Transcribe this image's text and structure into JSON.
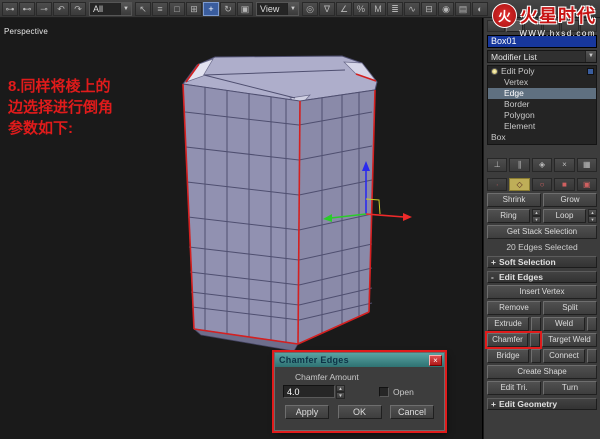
{
  "ui": {
    "dropdown_arrow": "▼",
    "spinner_up": "▲",
    "spinner_down": "▼",
    "close_glyph": "×"
  },
  "colors": {
    "highlight_red": "#e01b1b",
    "selected_edge": "#d42020",
    "dialog_title_teal": "#3f8f8f",
    "object_name_blue": "#17379d",
    "face_lavender": "#9191b1"
  },
  "toolbar": {
    "selection_filter": "All",
    "ref_coord": "View",
    "icons": [
      {
        "name": "select-and-link",
        "glyph": "⊶"
      },
      {
        "name": "unlink-selection",
        "glyph": "⊷"
      },
      {
        "name": "bind-to-space-warp",
        "glyph": "⊸"
      },
      {
        "name": "undo",
        "glyph": "↶"
      },
      {
        "name": "redo",
        "glyph": "↷"
      },
      {
        "name": "select-object",
        "glyph": "↖"
      },
      {
        "name": "select-by-name",
        "glyph": "≡"
      },
      {
        "name": "rectangular-selection",
        "glyph": "□"
      },
      {
        "name": "window-crossing",
        "glyph": "⊞"
      },
      {
        "name": "select-and-move",
        "glyph": "+"
      },
      {
        "name": "select-and-rotate",
        "glyph": "↻"
      },
      {
        "name": "select-and-scale",
        "glyph": "▣"
      },
      {
        "name": "use-pivot-center",
        "glyph": "◎"
      },
      {
        "name": "snap-toggle",
        "glyph": "∇"
      },
      {
        "name": "angle-snap",
        "glyph": "∠"
      },
      {
        "name": "percent-snap",
        "glyph": "%"
      },
      {
        "name": "mirror",
        "glyph": "M"
      },
      {
        "name": "align",
        "glyph": "≣"
      },
      {
        "name": "curve-editor",
        "glyph": "∿"
      },
      {
        "name": "schematic-view",
        "glyph": "⊟"
      },
      {
        "name": "material-editor",
        "glyph": "◉"
      },
      {
        "name": "render-setup",
        "glyph": "▤"
      },
      {
        "name": "quick-render",
        "glyph": "◐"
      }
    ]
  },
  "viewport": {
    "label": "Perspective",
    "annotation_lines": [
      "8.同样将棱上的",
      "边选择进行倒角",
      "参数如下:"
    ]
  },
  "dialog": {
    "title": "Chamfer Edges",
    "amount_label": "Chamfer Amount",
    "amount_value": "4.0",
    "open_label": "Open",
    "buttons": {
      "apply": "Apply",
      "ok": "OK",
      "cancel": "Cancel"
    }
  },
  "panel": {
    "object_name": "Box01",
    "modifier_list_label": "Modifier List",
    "stack_items": [
      {
        "label": "Edit Poly"
      },
      {
        "label": "Vertex"
      },
      {
        "label": "Edge"
      },
      {
        "label": "Border"
      },
      {
        "label": "Polygon"
      },
      {
        "label": "Element"
      },
      {
        "label": "Box"
      }
    ],
    "stack_icons": [
      {
        "name": "pin-stack",
        "glyph": "⊥"
      },
      {
        "name": "show-end-result",
        "glyph": "∥"
      },
      {
        "name": "make-unique",
        "glyph": "◈"
      },
      {
        "name": "remove-modifier",
        "glyph": "×"
      },
      {
        "name": "configure-modifier-sets",
        "glyph": "▦"
      }
    ],
    "subobj_icons": [
      {
        "name": "vertex-mode",
        "glyph": "∙"
      },
      {
        "name": "edge-mode",
        "glyph": "◇"
      },
      {
        "name": "border-mode",
        "glyph": "○"
      },
      {
        "name": "polygon-mode",
        "glyph": "■"
      },
      {
        "name": "element-mode",
        "glyph": "▣"
      }
    ],
    "selection": {
      "shrink": "Shrink",
      "grow": "Grow",
      "ring": "Ring",
      "loop": "Loop",
      "get_stack_selection": "Get Stack Selection",
      "status": "20 Edges Selected"
    },
    "rollouts": {
      "soft_selection": {
        "sign": "+",
        "label": "Soft Selection"
      },
      "edit_edges": {
        "sign": "-",
        "label": "Edit Edges"
      },
      "edit_geometry": {
        "sign": "+",
        "label": "Edit Geometry"
      }
    },
    "edit_edges": {
      "insert_vertex": "Insert Vertex",
      "remove": "Remove",
      "split": "Split",
      "extrude": "Extrude",
      "weld": "Weld",
      "chamfer": "Chamfer",
      "target_weld": "Target Weld",
      "bridge": "Bridge",
      "connect": "Connect",
      "create_shape": "Create Shape",
      "edit_tri": "Edit Tri.",
      "turn": "Turn"
    }
  },
  "watermark": {
    "logo_glyph": "火",
    "brand": "火星时代",
    "url": "WWW.hxsd.com"
  }
}
